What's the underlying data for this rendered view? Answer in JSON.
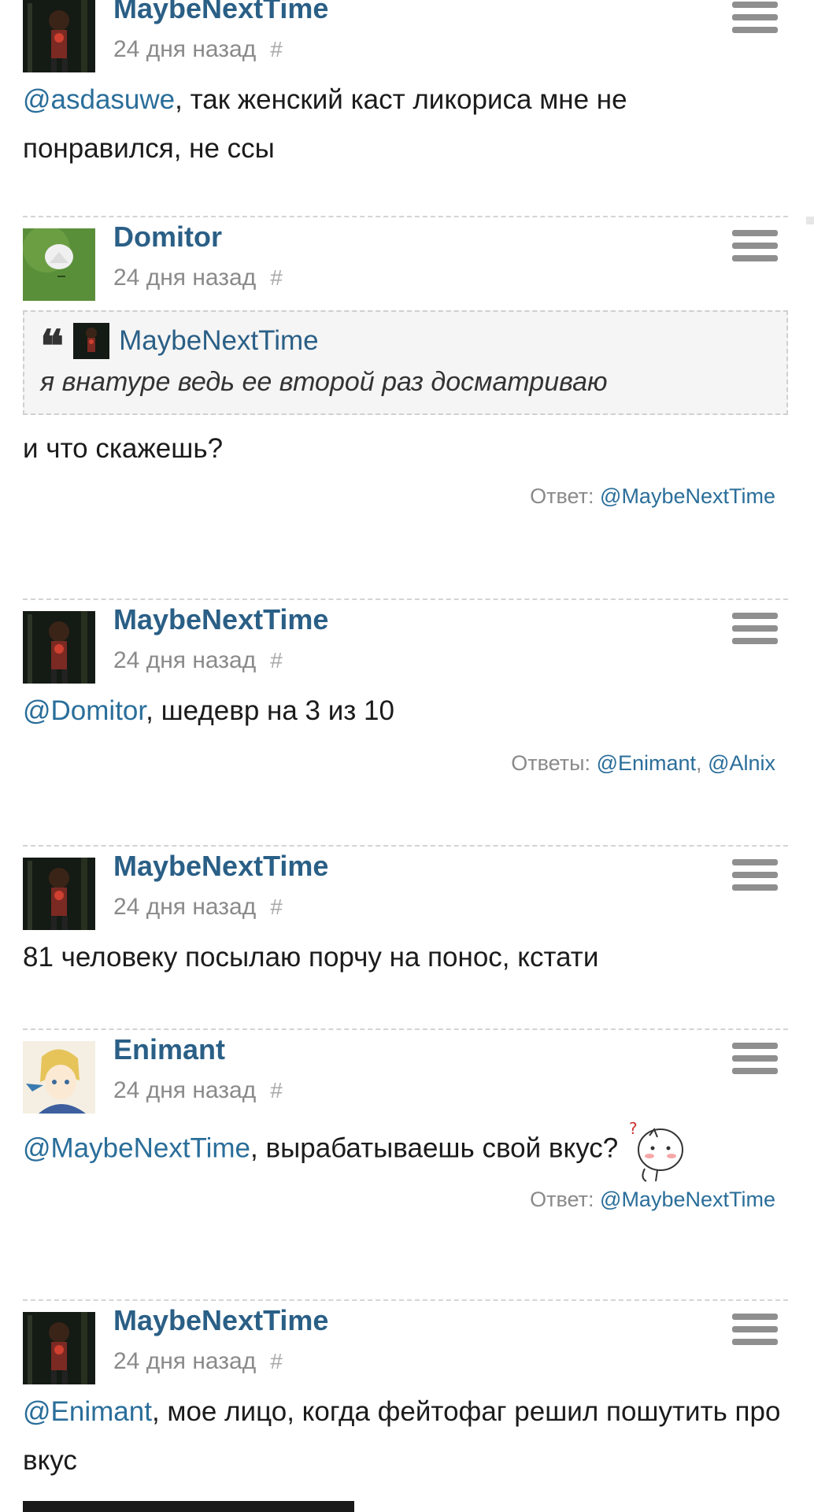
{
  "comments": [
    {
      "user": "MaybeNextTime",
      "time": "24 дня назад",
      "hash": "#",
      "mention": "@asdasuwe",
      "text": ", так женский каст ликориса мне не понравился, не ссы"
    },
    {
      "user": "Domitor",
      "time": "24 дня назад",
      "hash": "#",
      "quote_user": "MaybeNextTime",
      "quote_text": "я внатуре ведь ее второй раз досматриваю",
      "text": "и что скажешь?",
      "replies_label": "Ответ:",
      "reply_1": "@MaybeNextTime"
    },
    {
      "user": "MaybeNextTime",
      "time": "24 дня назад",
      "hash": "#",
      "mention": "@Domitor",
      "text": ", шедевр на 3 из 10",
      "replies_label": "Ответы:",
      "reply_1": "@Enimant",
      "sep": ", ",
      "reply_2": "@Alnix"
    },
    {
      "user": "MaybeNextTime",
      "time": "24 дня назад",
      "hash": "#",
      "text": "81 человеку посылаю порчу на понос, кстати"
    },
    {
      "user": "Enimant",
      "time": "24 дня назад",
      "hash": "#",
      "mention": "@MaybeNextTime",
      "text": ", вырабатываешь свой вкус?",
      "replies_label": "Ответ:",
      "reply_1": "@MaybeNextTime"
    },
    {
      "user": "MaybeNextTime",
      "time": "24 дня назад",
      "hash": "#",
      "mention": "@Enimant",
      "text": ", мое лицо, когда фейтофаг решил пошутить про вкус"
    }
  ],
  "colors": {
    "link": "#2a6e9a",
    "username": "#2a5f86",
    "meta": "#8a8a8a",
    "divider": "#d4d4d4"
  }
}
